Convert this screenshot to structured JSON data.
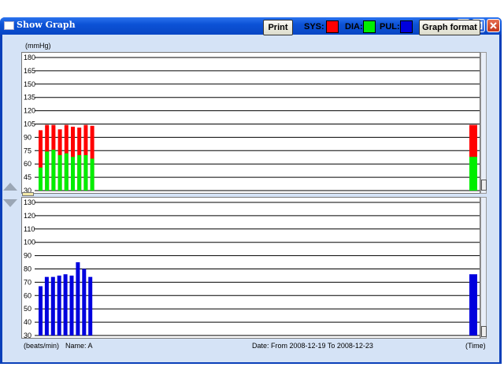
{
  "window": {
    "title": "Show Graph"
  },
  "toolbar": {
    "print_label": "Print",
    "graph_format_label": "Graph format"
  },
  "legend": [
    {
      "label": "SYS:",
      "color": "#ff0000"
    },
    {
      "label": "DIA:",
      "color": "#00ee00"
    },
    {
      "label": "PUL:",
      "color": "#0000dd"
    }
  ],
  "top_chart": {
    "unit": "(mmHg)"
  },
  "bottom_chart": {
    "unit": "(beats/min)"
  },
  "footer": {
    "name": "Name: A",
    "date_range": "Date: From 2008-12-19 To 2008-12-23",
    "time_label": "(Time)"
  },
  "chart_data": [
    {
      "type": "bar",
      "title": "",
      "ylabel": "(mmHg)",
      "yticks": [
        30,
        45,
        60,
        75,
        90,
        105,
        120,
        135,
        150,
        165,
        180
      ],
      "ylim": [
        30,
        180
      ],
      "series": [
        {
          "name": "SYS",
          "color": "#ff0000",
          "values": [
            98,
            104,
            104,
            99,
            104,
            102,
            101,
            104,
            103
          ]
        },
        {
          "name": "DIA",
          "color": "#00ee00",
          "values": [
            56,
            74,
            76,
            70,
            72,
            68,
            70,
            70,
            66,
            68
          ]
        }
      ],
      "sys_values": [
        98,
        104,
        104,
        99,
        104,
        102,
        101,
        104,
        103
      ],
      "dia_values": [
        56,
        74,
        76,
        70,
        72,
        68,
        70,
        70,
        66
      ],
      "summary": {
        "sys": 104,
        "dia": 68
      }
    },
    {
      "type": "bar",
      "title": "",
      "ylabel": "(beats/min)",
      "yticks": [
        30,
        40,
        50,
        60,
        70,
        80,
        90,
        100,
        110,
        120,
        130
      ],
      "ylim": [
        30,
        130
      ],
      "series": [
        {
          "name": "PUL",
          "color": "#0000dd",
          "values": [
            67,
            74,
            74,
            75,
            76,
            75,
            85,
            80,
            74
          ]
        }
      ],
      "summary": {
        "pul": 76
      }
    }
  ]
}
